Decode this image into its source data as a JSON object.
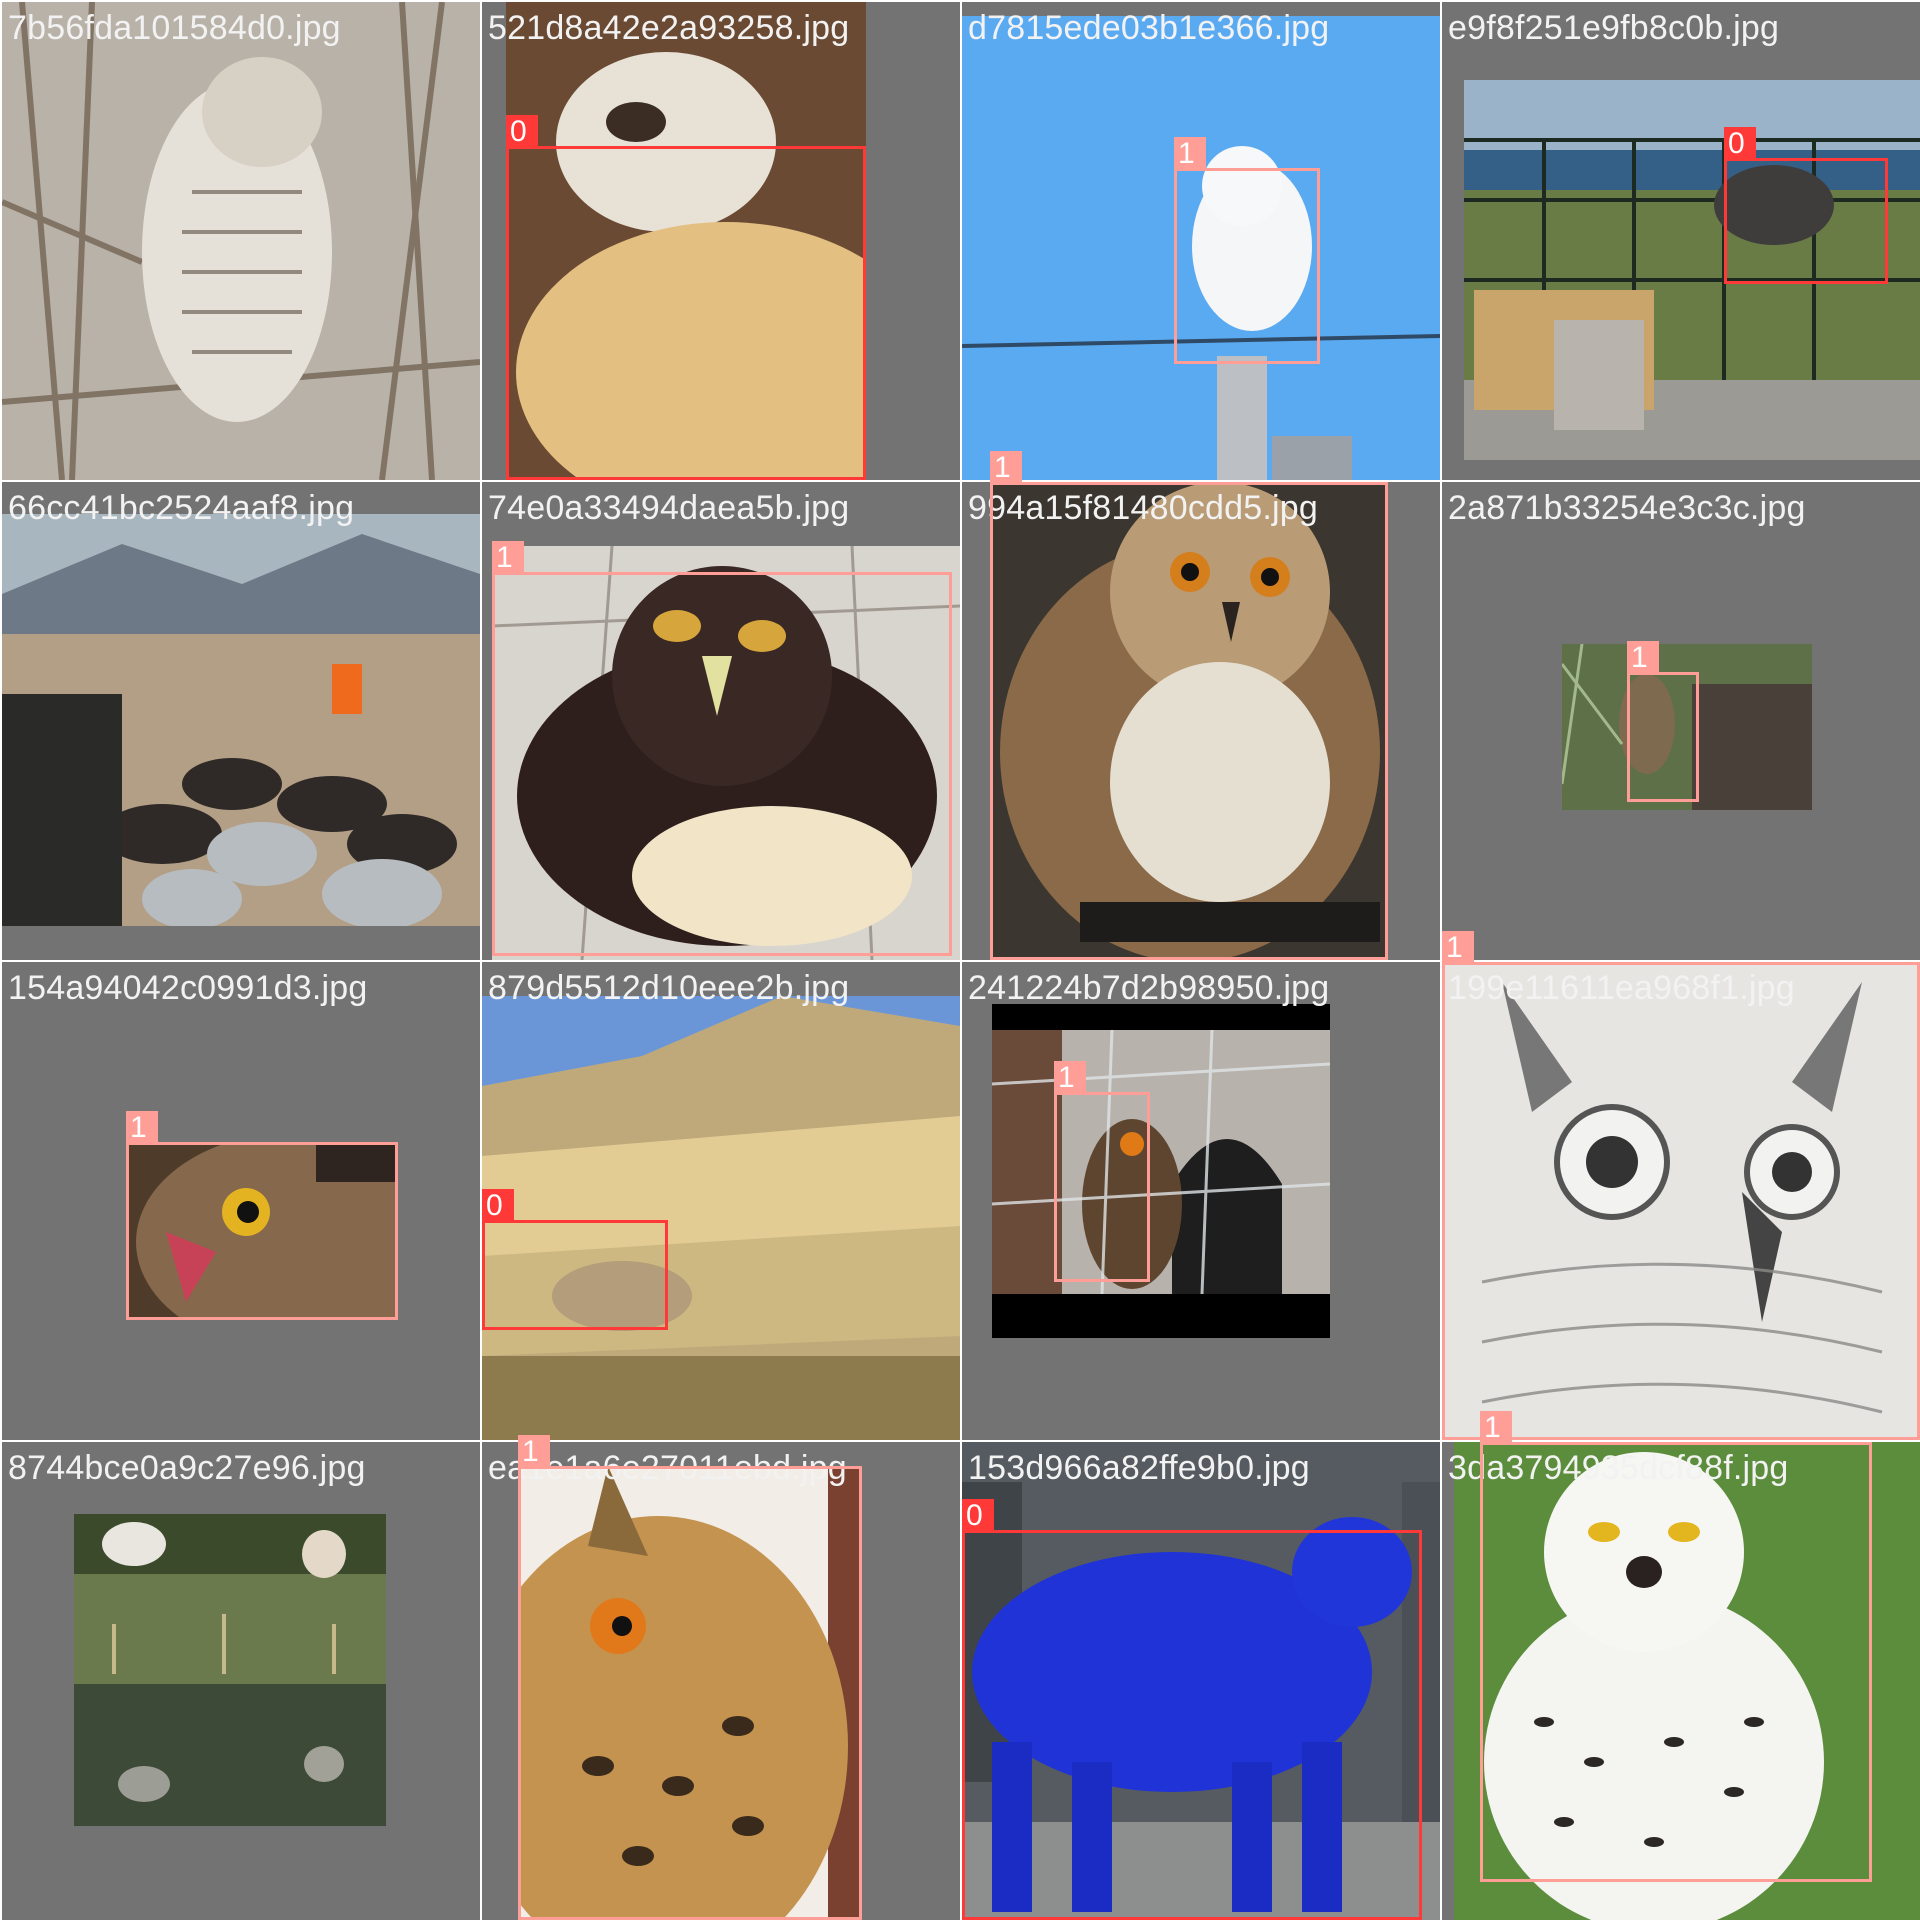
{
  "colors": {
    "tile_background": "#737373",
    "class_0": "#ff3838",
    "class_1": "#ff9d97",
    "filename_text": "#f2f2f2"
  },
  "tiles": [
    {
      "filename": "7b56fda101584d0.jpg",
      "image_desc": "barred owl sleeping among twigs",
      "boxes": []
    },
    {
      "filename": "521d8a42e2a93258.jpg",
      "image_desc": "two sheep close-up",
      "boxes": [
        {
          "label": "0"
        }
      ]
    },
    {
      "filename": "d7815ede03b1e366.jpg",
      "image_desc": "snowy owl on pole against blue sky",
      "boxes": [
        {
          "label": "1"
        }
      ]
    },
    {
      "filename": "e9f8f251e9fb8c0b.jpg",
      "image_desc": "dark sheep behind fence near sea",
      "boxes": [
        {
          "label": "0"
        }
      ]
    },
    {
      "filename": "66cc41bc2524aaf8.jpg",
      "image_desc": "flock of sheep at market with mountains",
      "boxes": []
    },
    {
      "filename": "74e0a33494daea5b.jpg",
      "image_desc": "spectacled owl on tiles",
      "boxes": [
        {
          "label": "1"
        }
      ]
    },
    {
      "filename": "994a15f81480cdd5.jpg",
      "image_desc": "long-eared owl on perch",
      "boxes": [
        {
          "label": "1"
        }
      ]
    },
    {
      "filename": "2a871b33254e3c3c.jpg",
      "image_desc": "small owl in tree",
      "boxes": [
        {
          "label": "1"
        }
      ]
    },
    {
      "filename": "154a94042c0991d3.jpg",
      "image_desc": "great horned owl close-up",
      "boxes": [
        {
          "label": "1"
        }
      ]
    },
    {
      "filename": "879d5512d10eee2b.jpg",
      "image_desc": "hillside fields with animals",
      "boxes": [
        {
          "label": "0"
        }
      ]
    },
    {
      "filename": "241224b7d2b98950.jpg",
      "image_desc": "eagle owl behind wire mesh",
      "boxes": [
        {
          "label": "1"
        }
      ]
    },
    {
      "filename": "199e11611ea968f1.jpg",
      "image_desc": "pencil drawing of owl face",
      "boxes": [
        {
          "label": "1"
        }
      ]
    },
    {
      "filename": "8744bce0a9c27e96.jpg",
      "image_desc": "two sheep by pond with reflection",
      "boxes": []
    },
    {
      "filename": "ea1e1a6e27011ebd.jpg",
      "image_desc": "eurasian eagle owl close-up",
      "boxes": [
        {
          "label": "1"
        }
      ]
    },
    {
      "filename": "153d966a82ffe9b0.jpg",
      "image_desc": "blue sheep sculpture on street",
      "boxes": [
        {
          "label": "0"
        }
      ]
    },
    {
      "filename": "3da3794935dcf88f.jpg",
      "image_desc": "snowy owl in grass",
      "boxes": [
        {
          "label": "1"
        }
      ]
    }
  ]
}
